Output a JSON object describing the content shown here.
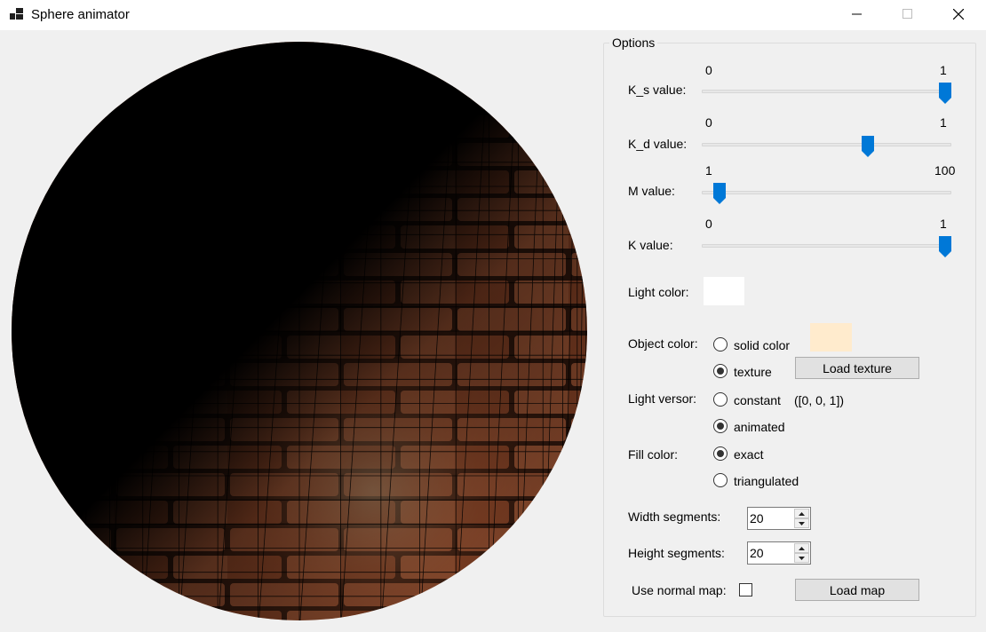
{
  "window": {
    "title": "Sphere animator",
    "icons": {
      "app": "app-icon",
      "minimize": "minimize-icon",
      "maximize": "maximize-icon",
      "close": "close-icon"
    }
  },
  "options": {
    "legend": "Options",
    "ks": {
      "label": "K_s value:",
      "min": "0",
      "max": "1",
      "value": 1.0
    },
    "kd": {
      "label": "K_d value:",
      "min": "0",
      "max": "1",
      "value": 0.67
    },
    "m": {
      "label": "M value:",
      "min": "1",
      "max": "100",
      "value": 1
    },
    "k": {
      "label": "K value:",
      "min": "0",
      "max": "1",
      "value": 1.0
    },
    "light_color": {
      "label": "Light color:",
      "color": "#ffffff"
    },
    "object_color": {
      "label": "Object color:",
      "solid_label": "solid color",
      "texture_label": "texture",
      "selected": "texture",
      "swatch_color": "#ffebcd",
      "load_texture_button": "Load texture"
    },
    "light_versor": {
      "label": "Light versor:",
      "constant_label": "constant",
      "constant_value": "([0, 0, 1])",
      "animated_label": "animated",
      "selected": "animated"
    },
    "fill_color": {
      "label": "Fill color:",
      "exact_label": "exact",
      "triangulated_label": "triangulated",
      "selected": "exact"
    },
    "width_segments": {
      "label": "Width segments:",
      "value": "20"
    },
    "height_segments": {
      "label": "Height segments:",
      "value": "20"
    },
    "normal_map": {
      "label": "Use normal map:",
      "checked": false,
      "load_button": "Load map"
    }
  },
  "colors": {
    "accent": "#0078d7",
    "slider_track": "#e7e7e7"
  }
}
